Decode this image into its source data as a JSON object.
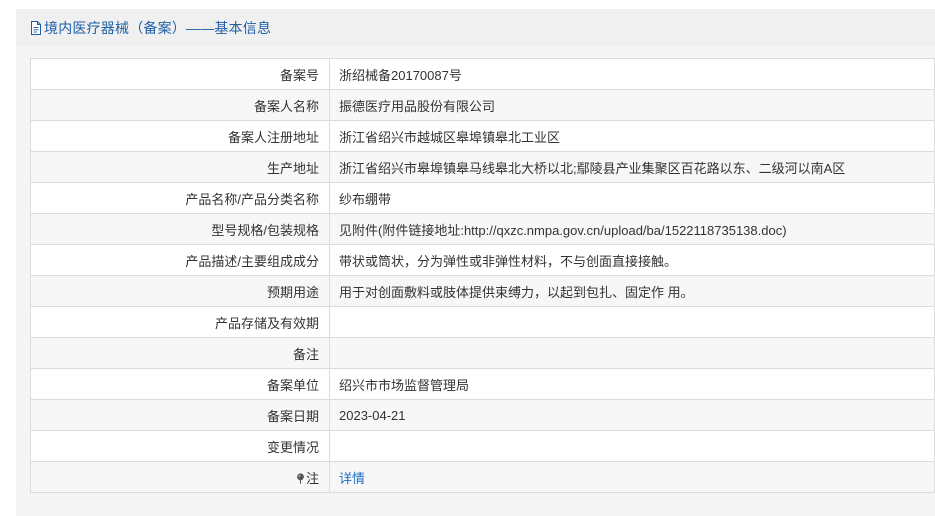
{
  "header": {
    "title": "境内医疗器械（备案）——基本信息"
  },
  "rows": [
    {
      "label": "备案号",
      "value": "浙绍械备20170087号"
    },
    {
      "label": "备案人名称",
      "value": "振德医疗用品股份有限公司"
    },
    {
      "label": "备案人注册地址",
      "value": "浙江省绍兴市越城区皋埠镇皋北工业区"
    },
    {
      "label": "生产地址",
      "value": "浙江省绍兴市皋埠镇皋马线皋北大桥以北;鄢陵县产业集聚区百花路以东、二级河以南A区"
    },
    {
      "label": "产品名称/产品分类名称",
      "value": "纱布绷带"
    },
    {
      "label": "型号规格/包装规格",
      "value": "见附件(附件链接地址:http://qxzc.nmpa.gov.cn/upload/ba/1522118735138.doc)"
    },
    {
      "label": "产品描述/主要组成成分",
      "value": "带状或筒状，分为弹性或非弹性材料，不与创面直接接触。"
    },
    {
      "label": "预期用途",
      "value": "用于对创面敷料或肢体提供束缚力，以起到包扎、固定作 用。"
    },
    {
      "label": "产品存储及有效期",
      "value": ""
    },
    {
      "label": "备注",
      "value": ""
    },
    {
      "label": "备案单位",
      "value": "绍兴市市场监督管理局"
    },
    {
      "label": "备案日期",
      "value": "2023-04-21"
    },
    {
      "label": "变更情况",
      "value": ""
    }
  ],
  "note_row": {
    "label": "注",
    "link_label": "详情",
    "icon": "pin-icon"
  },
  "colors": {
    "title": "#1f5fa6",
    "link": "#1f6fc5",
    "border": "#dcdcdc",
    "row_alt": "#f7f7f7"
  }
}
